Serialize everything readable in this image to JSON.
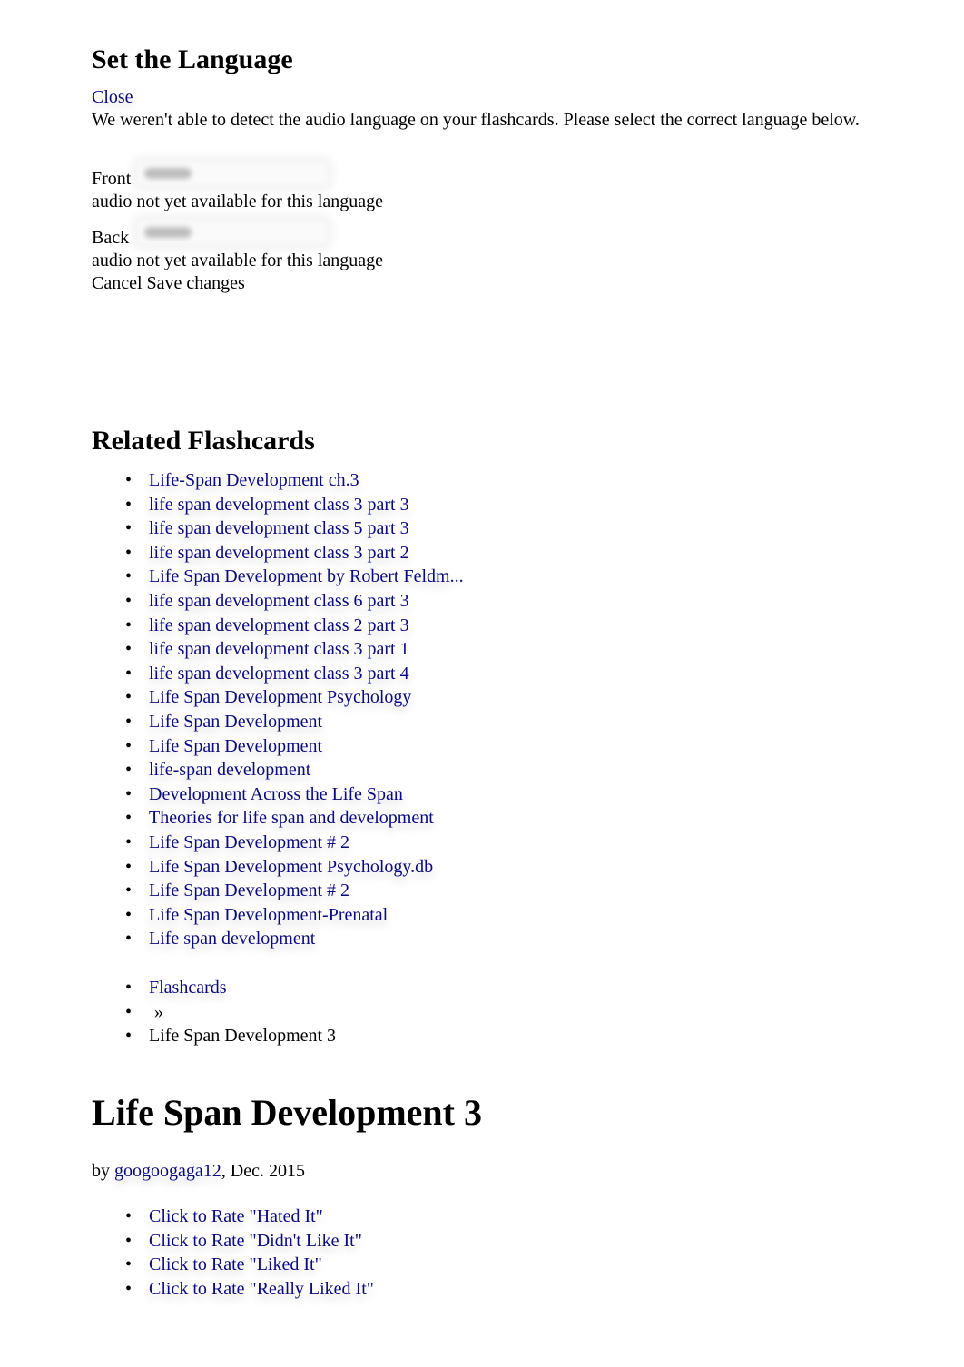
{
  "language_dialog": {
    "title": "Set the Language",
    "close_label": "Close",
    "description": "We weren't able to detect the audio language on your flashcards. Please select the correct language below.",
    "front": {
      "label": "Front",
      "note": "audio not yet available for this language"
    },
    "back": {
      "label": "Back",
      "note": "audio not yet available for this language"
    },
    "cancel_label": "Cancel",
    "save_label": "Save changes"
  },
  "related": {
    "title": "Related Flashcards",
    "items": [
      "Life-Span Development ch.3",
      "life span development class 3 part 3",
      "life span development class 5 part 3",
      "life span development class 3 part 2",
      "Life Span Development by Robert Feldm...",
      "life span development class 6 part 3",
      "life span development class 2 part 3",
      "life span development class 3 part 1",
      "life span development class 3 part 4",
      "Life Span Development Psychology",
      "Life Span Development",
      "Life Span Development",
      "life-span development",
      "Development Across the Life Span",
      "Theories for life span and development",
      "Life Span Development # 2",
      "Life Span Development Psychology.db",
      "Life Span Development # 2",
      "Life Span Development-Prenatal",
      "Life span development"
    ]
  },
  "breadcrumb": {
    "root": "Flashcards",
    "separator": "»",
    "current": "Life Span Development 3"
  },
  "deck": {
    "title": "Life Span Development 3",
    "by_prefix": "by ",
    "author": "googoogaga12",
    "date_suffix": ", Dec. 2015"
  },
  "rating": {
    "options": [
      "Click to Rate \"Hated It\"",
      "Click to Rate \"Didn't Like It\"",
      "Click to Rate \"Liked It\"",
      "Click to Rate \"Really Liked It\""
    ]
  },
  "colors": {
    "link": "#0b0b80",
    "text": "#000000",
    "background": "#ffffff"
  }
}
